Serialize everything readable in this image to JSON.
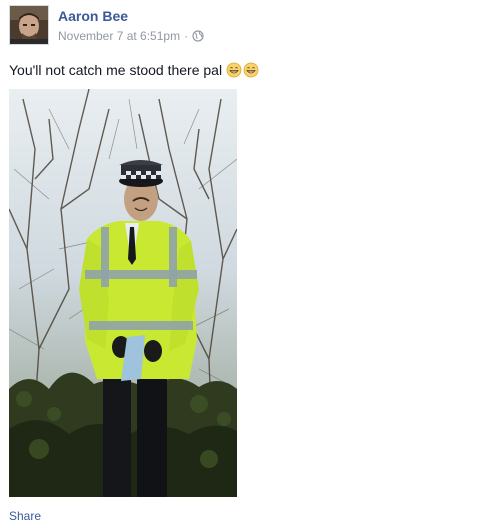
{
  "post": {
    "author": {
      "name": "Aaron Bee",
      "avatar_icon": "profile-photo"
    },
    "timestamp": "November 7 at 6:51pm",
    "separator": "·",
    "audience_icon": "globe-icon",
    "message": "You'll not catch me stood there pal",
    "emoji": [
      "grinning-face-icon",
      "grinning-face-icon"
    ],
    "photo_icon": "photo-police-scarecrow",
    "actions": {
      "share_label": "Share"
    }
  },
  "colors": {
    "link_blue": "#3b5998",
    "meta_gray": "#9197a3",
    "text": "#141823",
    "hi_vis_yellow": "#c8e832"
  }
}
